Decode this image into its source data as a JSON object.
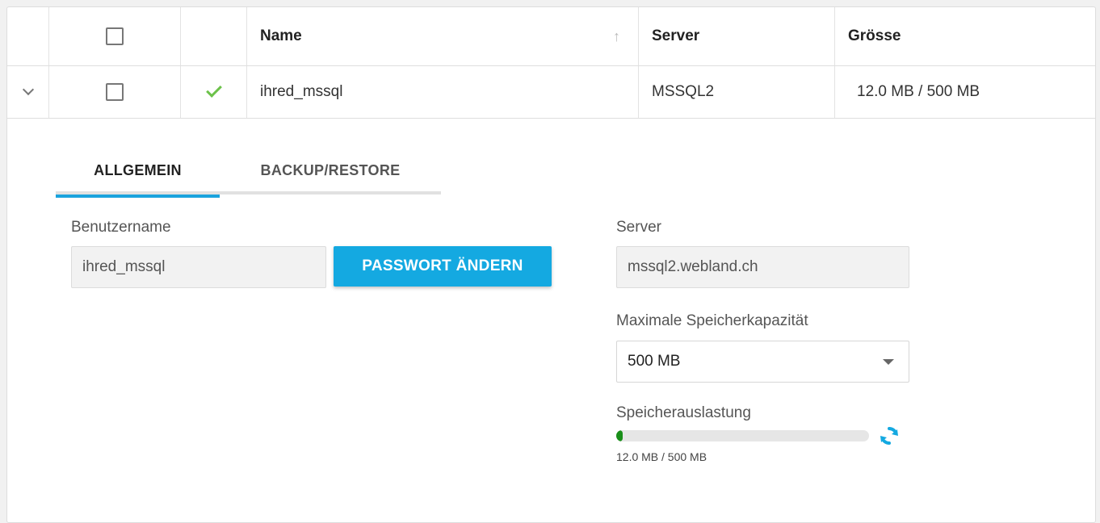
{
  "table": {
    "columns": {
      "name": "Name",
      "server": "Server",
      "size": "Grösse"
    },
    "sort_icon": "arrow-up-icon",
    "rows": [
      {
        "name": "ihred_mssql",
        "server": "MSSQL2",
        "size": "12.0 MB / 500 MB",
        "status_icon": "checkmark-icon",
        "expanded": true
      }
    ]
  },
  "details": {
    "tabs": [
      {
        "label": "ALLGEMEIN",
        "active": true
      },
      {
        "label": "BACKUP/RESTORE",
        "active": false
      }
    ],
    "username_label": "Benutzername",
    "username_value": "ihred_mssql",
    "change_password_label": "PASSWORT ÄNDERN",
    "server_label": "Server",
    "server_value": "mssql2.webland.ch",
    "max_storage_label": "Maximale Speicherkapazität",
    "max_storage_value": "500 MB",
    "usage_label": "Speicherauslastung",
    "usage_text": "12.0 MB / 500 MB",
    "usage_fraction": 0.024
  },
  "colors": {
    "accent": "#14a9e1",
    "success": "#6cc24a",
    "progress": "#1a8f1a"
  }
}
